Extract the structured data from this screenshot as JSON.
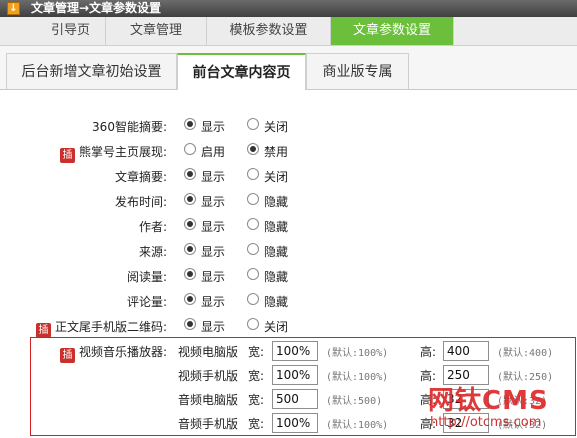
{
  "title": "文章管理→文章参数设置",
  "title_icon": "download-arrow-icon",
  "main_tabs": [
    {
      "label": "引导页",
      "active": false
    },
    {
      "label": "文章管理",
      "active": false
    },
    {
      "label": "模板参数设置",
      "active": false
    },
    {
      "label": "文章参数设置",
      "active": true
    }
  ],
  "sub_tabs": [
    {
      "label": "后台新增文章初始设置",
      "active": false
    },
    {
      "label": "前台文章内容页",
      "active": true
    },
    {
      "label": "商业版专属",
      "active": false
    }
  ],
  "plugin_badge": "插",
  "settings": [
    {
      "label": "360智能摘要:",
      "plugin": false,
      "options": [
        "显示",
        "关闭"
      ],
      "selected": 0
    },
    {
      "label": "熊掌号主页展现:",
      "plugin": true,
      "options": [
        "启用",
        "禁用"
      ],
      "selected": 1
    },
    {
      "label": "文章摘要:",
      "plugin": false,
      "options": [
        "显示",
        "关闭"
      ],
      "selected": 0
    },
    {
      "label": "发布时间:",
      "plugin": false,
      "options": [
        "显示",
        "隐藏"
      ],
      "selected": 0
    },
    {
      "label": "作者:",
      "plugin": false,
      "options": [
        "显示",
        "隐藏"
      ],
      "selected": 0
    },
    {
      "label": "来源:",
      "plugin": false,
      "options": [
        "显示",
        "隐藏"
      ],
      "selected": 0
    },
    {
      "label": "阅读量:",
      "plugin": false,
      "options": [
        "显示",
        "隐藏"
      ],
      "selected": 0
    },
    {
      "label": "评论量:",
      "plugin": false,
      "options": [
        "显示",
        "隐藏"
      ],
      "selected": 0
    },
    {
      "label": "正文尾手机版二维码:",
      "plugin": true,
      "options": [
        "显示",
        "关闭"
      ],
      "selected": 0
    }
  ],
  "player": {
    "label": "视频音乐播放器:",
    "width_label": "宽:",
    "height_label": "高:",
    "rows": [
      {
        "name": "视频电脑版",
        "width": "100%",
        "width_default": "(默认:100%)",
        "height": "400",
        "height_default": "(默认:400)"
      },
      {
        "name": "视频手机版",
        "width": "100%",
        "width_default": "(默认:100%)",
        "height": "250",
        "height_default": "(默认:250)"
      },
      {
        "name": "音频电脑版",
        "width": "500",
        "width_default": "(默认:500)",
        "height": "32",
        "height_default": "(默认:32)"
      },
      {
        "name": "音频手机版",
        "width": "100%",
        "width_default": "(默认:100%)",
        "height": "32",
        "height_default": "(默认:32)"
      }
    ]
  },
  "watermark": {
    "logo": "网钛CMS",
    "url": "http://otcms.com"
  }
}
